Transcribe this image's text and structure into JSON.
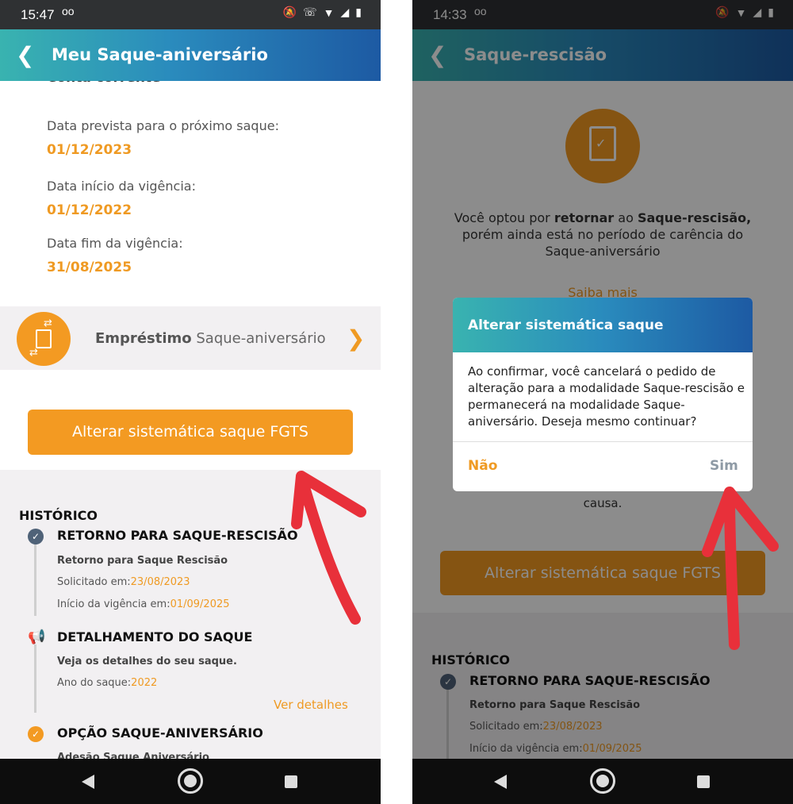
{
  "left_screen": {
    "status": {
      "time": "15:47",
      "voicemail": "oo",
      "icons": [
        "mute-icon",
        "wifi-call-icon",
        "wifi-icon",
        "signal-icon",
        "battery-icon"
      ]
    },
    "header": {
      "title": "Meu Saque-aniversário"
    },
    "partial_text": "Conta corrente",
    "info": [
      {
        "label": "Data prevista para o próximo saque:",
        "value": "01/12/2023"
      },
      {
        "label": "Data início da vigência:",
        "value": "01/12/2022"
      },
      {
        "label": "Data fim da vigência:",
        "value": "31/08/2025"
      }
    ],
    "emprestimo": {
      "bold": "Empréstimo",
      "rest": "Saque-aniversário"
    },
    "main_button": "Alterar sistemática saque FGTS",
    "historico": {
      "title": "HISTÓRICO",
      "items": [
        {
          "title": "RETORNO PARA SAQUE-RESCISÃO",
          "sub": "Retorno para Saque Rescisão",
          "line1_label": "Solicitado em:",
          "line1_value": "23/08/2023",
          "line2_label": "Início da vigência em:",
          "line2_value": "01/09/2025"
        },
        {
          "title": "DETALHAMENTO DO SAQUE",
          "sub": "Veja os detalhes do seu saque.",
          "line1_label": "Ano do saque:",
          "line1_value": "2022",
          "link": "Ver detalhes"
        },
        {
          "title": "OPÇÃO SAQUE-ANIVERSÁRIO",
          "sub": "Adesão Saque Aniversário"
        }
      ]
    }
  },
  "right_screen": {
    "status": {
      "time": "14:33",
      "voicemail": "oo",
      "icons": [
        "mute-icon",
        "wifi-icon",
        "signal-icon",
        "battery-icon"
      ]
    },
    "header": {
      "title": "Saque-rescisão"
    },
    "message_pre": "Você optou por ",
    "message_bold1": "retornar",
    "message_mid": " ao ",
    "message_bold2": "Saque-rescisão,",
    "message_line2": "porém ainda está no período de carência do",
    "message_line3": "Saque-aniversário",
    "saiba_mais": "Saiba mais",
    "hidden_line_end": "causa.",
    "main_button": "Alterar sistemática saque FGTS",
    "dialog": {
      "title": "Alterar sistemática saque",
      "body": "Ao confirmar, você cancelará o pedido de alteração para a modalidade Saque-rescisão e permanecerá na modalidade Saque-aniversário. Deseja mesmo continuar?",
      "no": "Não",
      "yes": "Sim"
    },
    "historico": {
      "title": "HISTÓRICO",
      "item": {
        "title": "RETORNO PARA SAQUE-RESCISÃO",
        "sub": "Retorno para Saque Rescisão",
        "line1_label": "Solicitado em:",
        "line1_value": "23/08/2023",
        "line2_label": "Início da vigência em:",
        "line2_value": "01/09/2025"
      }
    }
  },
  "colors": {
    "accent": "#ef9a23",
    "header_start": "#39b3b0",
    "header_end": "#1d5aa3",
    "annotation": "#e8303a"
  }
}
